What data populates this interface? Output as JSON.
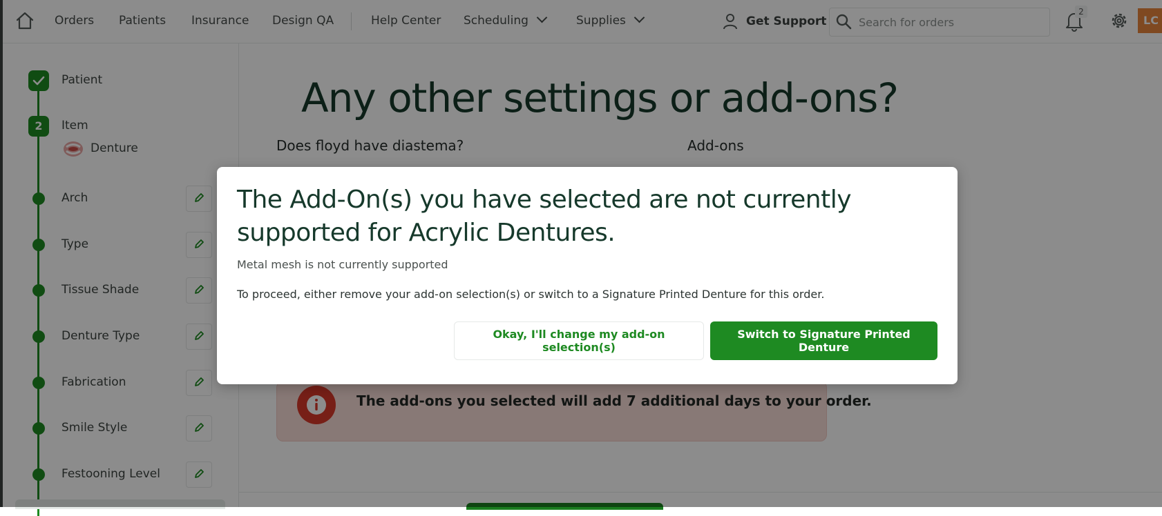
{
  "nav": {
    "items": [
      "Orders",
      "Patients",
      "Insurance",
      "Design QA",
      "Help Center",
      "Scheduling",
      "Supplies"
    ],
    "support_label": "Get Support",
    "search_placeholder": "Search for orders",
    "notification_count": "2",
    "avatar_initials": "LC"
  },
  "sidebar": {
    "steps": [
      {
        "label": "Patient",
        "state": "complete"
      },
      {
        "label": "Item",
        "state": "current",
        "number": "2",
        "selection": "Denture"
      },
      {
        "label": "Arch"
      },
      {
        "label": "Type"
      },
      {
        "label": "Tissue Shade"
      },
      {
        "label": "Denture Type"
      },
      {
        "label": "Fabrication"
      },
      {
        "label": "Smile Style"
      },
      {
        "label": "Festooning Level"
      }
    ]
  },
  "main": {
    "title": "Any other settings or add-ons?",
    "diastema_question": "Does floyd have diastema?",
    "addons_label": "Add-ons",
    "info_message": "The add-ons you selected will add 7 additional days to your order."
  },
  "modal": {
    "title": "The Add-On(s) you have selected are not currently supported for Acrylic Dentures.",
    "subtitle": "Metal mesh is not currently supported",
    "body": "To proceed, either remove your add-on selection(s) or switch to a Signature Printed Denture for this order.",
    "secondary_button": "Okay, I'll change my add-on selection(s)",
    "primary_button": "Switch to Signature Printed Denture"
  },
  "colors": {
    "brand_green": "#1e8a22",
    "title_green": "#16392b",
    "alert_red": "#d93a2b",
    "avatar_orange": "#e8853d"
  }
}
